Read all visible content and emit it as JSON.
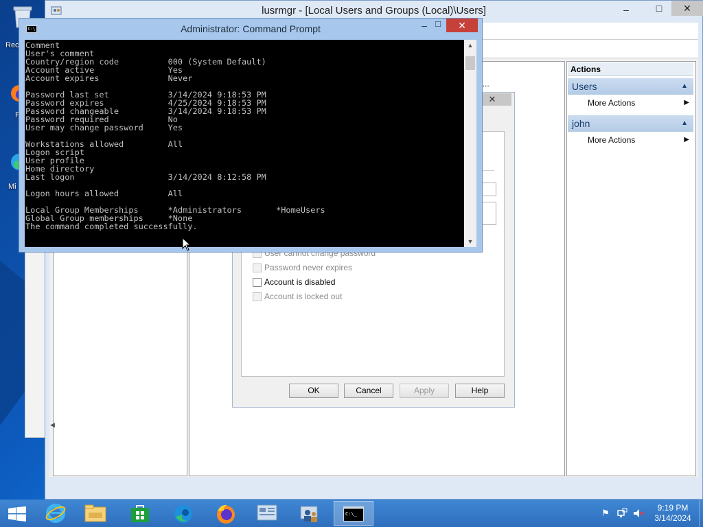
{
  "desktop": {
    "icons": [
      {
        "label": "Rec"
      },
      {
        "label": "Fi"
      },
      {
        "label": "Mi"
      }
    ]
  },
  "lusrmgr": {
    "title": "lusrmgr - [Local Users and Groups (Local)\\Users]",
    "list_partial_text": "g...",
    "actions": {
      "header": "Actions",
      "sections": [
        {
          "title": "Users",
          "items": [
            {
              "label": "More Actions"
            }
          ]
        },
        {
          "title": "john",
          "items": [
            {
              "label": "More Actions"
            }
          ]
        }
      ]
    }
  },
  "properties_dialog": {
    "checkboxes": [
      {
        "label": "User cannot change password",
        "checked": false,
        "enabled": false
      },
      {
        "label": "Password never expires",
        "checked": false,
        "enabled": false
      },
      {
        "label": "Account is disabled",
        "checked": false,
        "enabled": true
      },
      {
        "label": "Account is locked out",
        "checked": false,
        "enabled": false
      }
    ],
    "buttons": {
      "ok": "OK",
      "cancel": "Cancel",
      "apply": "Apply",
      "help": "Help"
    }
  },
  "cmd": {
    "title": "Administrator: Command Prompt",
    "icon_text": "C:\\",
    "output": "Comment\nUser's comment\nCountry/region code          000 (System Default)\nAccount active               Yes\nAccount expires              Never\n\nPassword last set            3/14/2024 9:18:53 PM\nPassword expires             4/25/2024 9:18:53 PM\nPassword changeable          3/14/2024 9:18:53 PM\nPassword required            No\nUser may change password     Yes\n\nWorkstations allowed         All\nLogon script\nUser profile\nHome directory\nLast logon                   3/14/2024 8:12:58 PM\n\nLogon hours allowed          All\n\nLocal Group Memberships      *Administrators       *HomeUsers\nGlobal Group memberships     *None\nThe command completed successfully."
  },
  "taskbar": {
    "apps": [
      {
        "name": "start",
        "icon": "windows-logo-icon"
      },
      {
        "name": "internet-explorer",
        "icon": "ie-icon"
      },
      {
        "name": "file-explorer",
        "icon": "folder-icon"
      },
      {
        "name": "store",
        "icon": "store-icon"
      },
      {
        "name": "edge",
        "icon": "edge-icon"
      },
      {
        "name": "firefox",
        "icon": "firefox-icon"
      },
      {
        "name": "server-manager",
        "icon": "server-manager-icon"
      },
      {
        "name": "computer-management",
        "icon": "users-icon"
      },
      {
        "name": "command-prompt",
        "icon": "cmd-icon",
        "active": true
      }
    ],
    "clock": {
      "time": "9:19 PM",
      "date": "3/14/2024"
    }
  },
  "colors": {
    "desktop_blue": "#0d5cc0",
    "taskbar": "#3f87d4",
    "cmd_frame": "#a7c8ec",
    "cmd_close": "#c7413b",
    "console_text": "#c0c0c0"
  }
}
